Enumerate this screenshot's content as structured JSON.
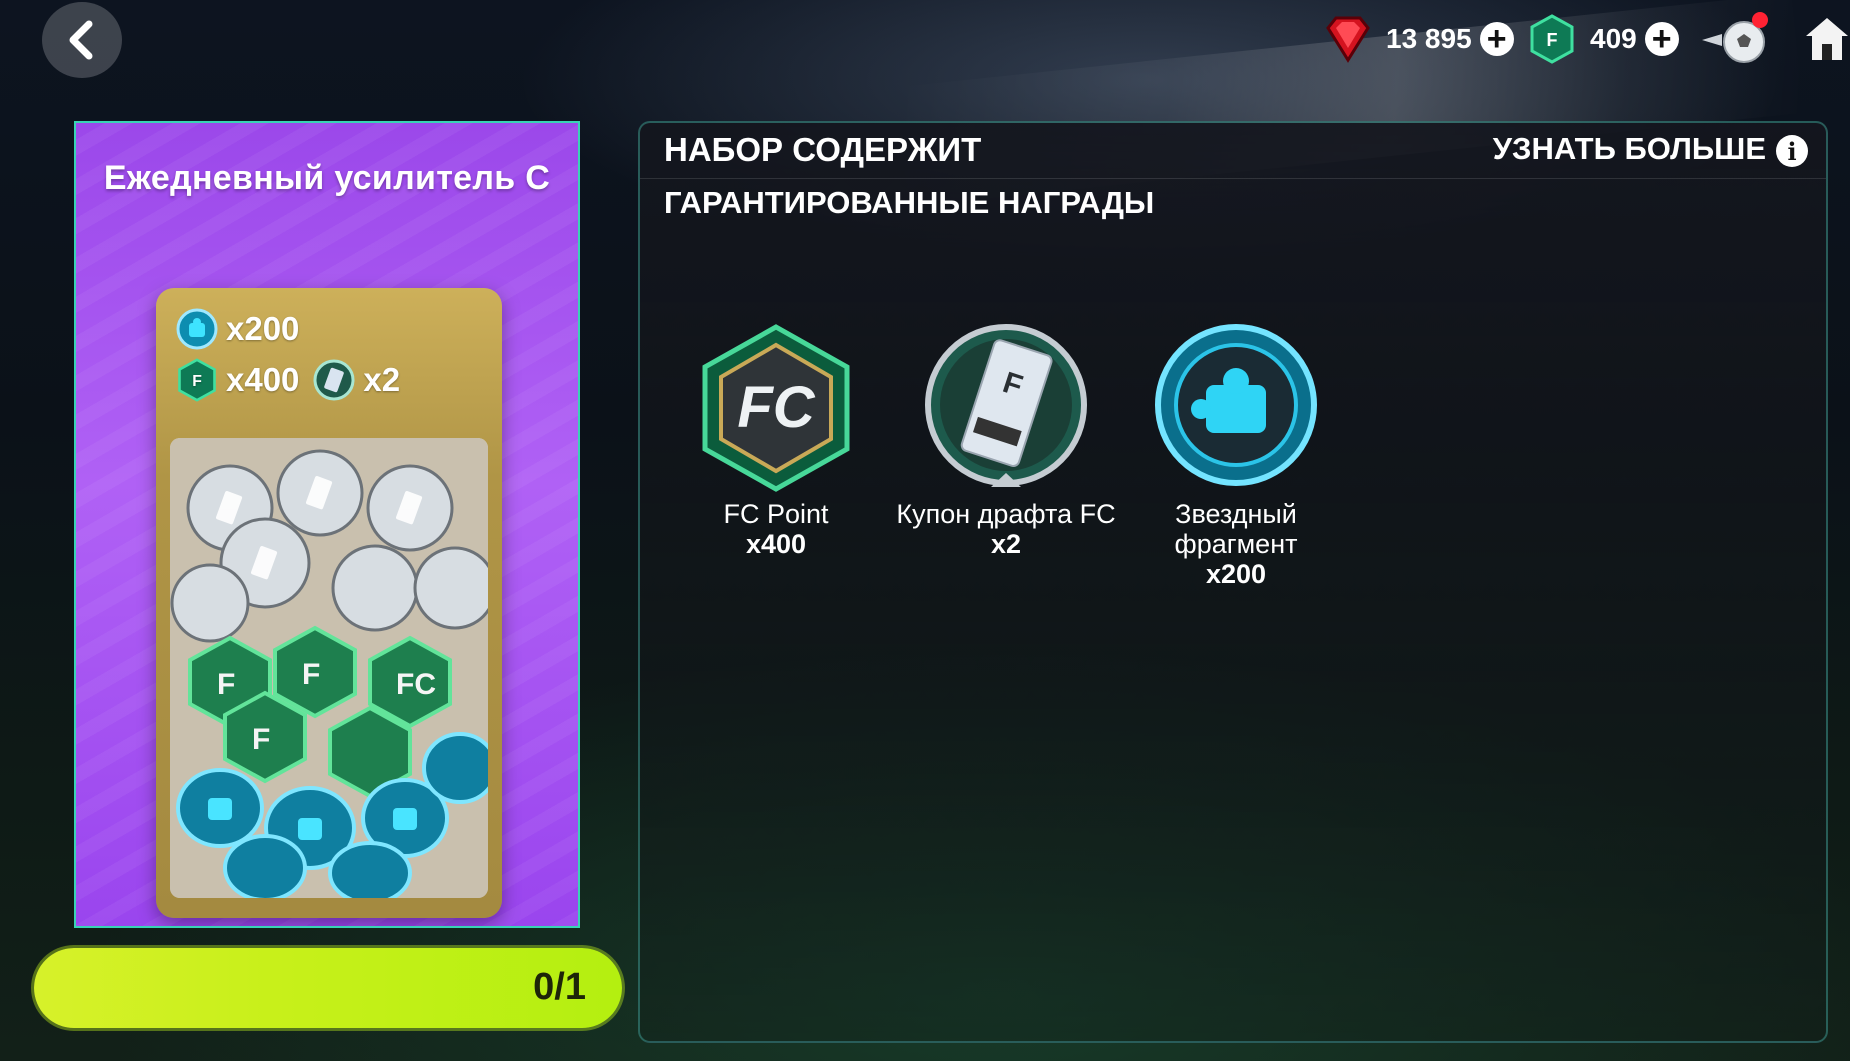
{
  "header": {
    "gems": {
      "value": "13 895",
      "icon": "red-gem-icon"
    },
    "fc_points": {
      "value": "409",
      "icon": "fc-point-icon"
    },
    "icons": [
      "back-icon",
      "plus-icon",
      "football-icon",
      "home-icon"
    ]
  },
  "pack": {
    "title": "Ежедневный усилитель С",
    "contents": [
      {
        "icon": "star-fragment-icon",
        "qty": "x200"
      },
      {
        "icon": "fc-point-icon",
        "qty": "x400"
      },
      {
        "icon": "draft-coupon-icon",
        "qty": "x2"
      }
    ]
  },
  "progress": {
    "text": "0/1",
    "fraction": 0
  },
  "panel": {
    "title": "НАБОР СОДЕРЖИТ",
    "learn_more": "УЗНАТЬ БОЛЬШЕ",
    "subtitle": "ГАРАНТИРОВАННЫЕ НАГРАДЫ",
    "rewards": [
      {
        "name": "FC Point",
        "qty": "x400",
        "icon": "fc-point-icon"
      },
      {
        "name": "Купон драфта FC",
        "qty": "x2",
        "icon": "draft-coupon-icon"
      },
      {
        "name": "Звездный фрагмент",
        "qty": "x200",
        "icon": "star-fragment-icon"
      }
    ]
  },
  "colors": {
    "accent_green": "#c8f01a",
    "panel_border": "#2fa596",
    "pack_purple": "#a855f0"
  }
}
